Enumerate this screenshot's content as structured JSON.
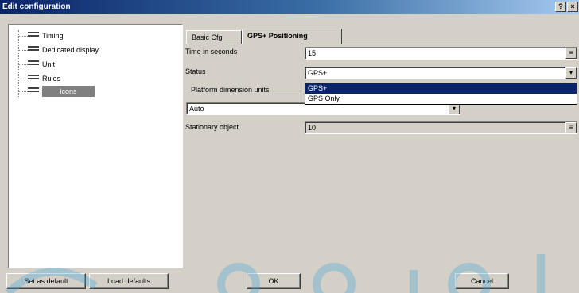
{
  "window": {
    "title": "Edit configuration",
    "help_glyph": "?",
    "close_glyph": "×"
  },
  "tree": {
    "items": [
      {
        "label": "Timing",
        "selected": false
      },
      {
        "label": "Dedicated display",
        "selected": false
      },
      {
        "label": "Unit",
        "selected": false
      },
      {
        "label": "Rules",
        "selected": false
      },
      {
        "label": "Icons",
        "selected": true
      }
    ]
  },
  "tabs": [
    {
      "label": "Basic Cfg",
      "active": false
    },
    {
      "label": "GPS+ Positioning",
      "active": true
    }
  ],
  "form": {
    "row1_label": "Time in seconds",
    "row1_value": "15",
    "row2_label": "Status",
    "row2_value": "GPS+",
    "row3_label": "Platform dimension units",
    "row3_value": "Auto",
    "row4_label": "Stationary object",
    "row4_value": "10"
  },
  "dropdown": {
    "options": [
      {
        "label": "GPS+",
        "selected": true
      },
      {
        "label": "GPS Only",
        "selected": false
      }
    ]
  },
  "buttons": {
    "left1": "Set as default",
    "left2": "Load defaults",
    "ok": "OK",
    "cancel": "Cancel"
  },
  "colors": {
    "title_start": "#0a246a",
    "title_end": "#a6caf0",
    "selection": "#0a246a",
    "face": "#d4d0c8",
    "watermark": "#4aa8d8"
  }
}
